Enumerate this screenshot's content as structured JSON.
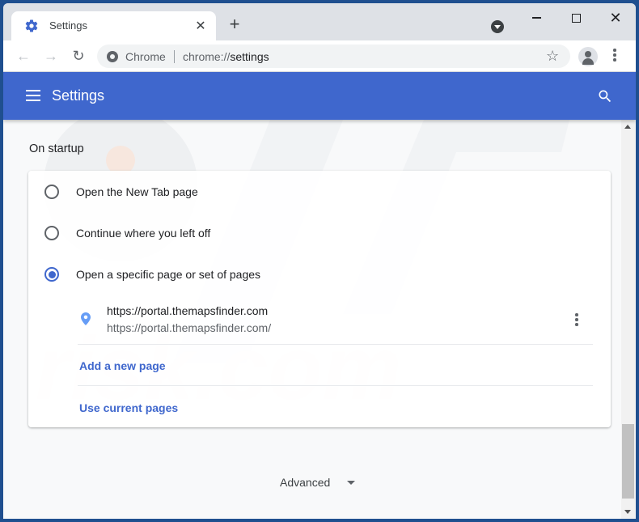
{
  "browser": {
    "tab": {
      "title": "Settings",
      "icon": "gear-icon"
    },
    "new_tab_symbol": "+",
    "close_tab_symbol": "✕",
    "window_close_symbol": "✕",
    "omnibox": {
      "scheme_label": "Chrome",
      "url_prefix": "chrome://",
      "url_path": "settings"
    },
    "nav": {
      "back": "←",
      "forward": "→",
      "reload": "↻"
    },
    "star_symbol": "☆"
  },
  "settings": {
    "header_title": "Settings",
    "section_title": "On startup",
    "options": [
      {
        "label": "Open the New Tab page",
        "checked": false
      },
      {
        "label": "Continue where you left off",
        "checked": false
      },
      {
        "label": "Open a specific page or set of pages",
        "checked": true
      }
    ],
    "pages": [
      {
        "title": "https://portal.themapsfinder.com",
        "url": "https://portal.themapsfinder.com/"
      }
    ],
    "add_page_label": "Add a new page",
    "use_current_label": "Use current pages",
    "advanced_label": "Advanced"
  },
  "colors": {
    "accent": "#3f67cd",
    "frame": "#1f4f8f"
  }
}
